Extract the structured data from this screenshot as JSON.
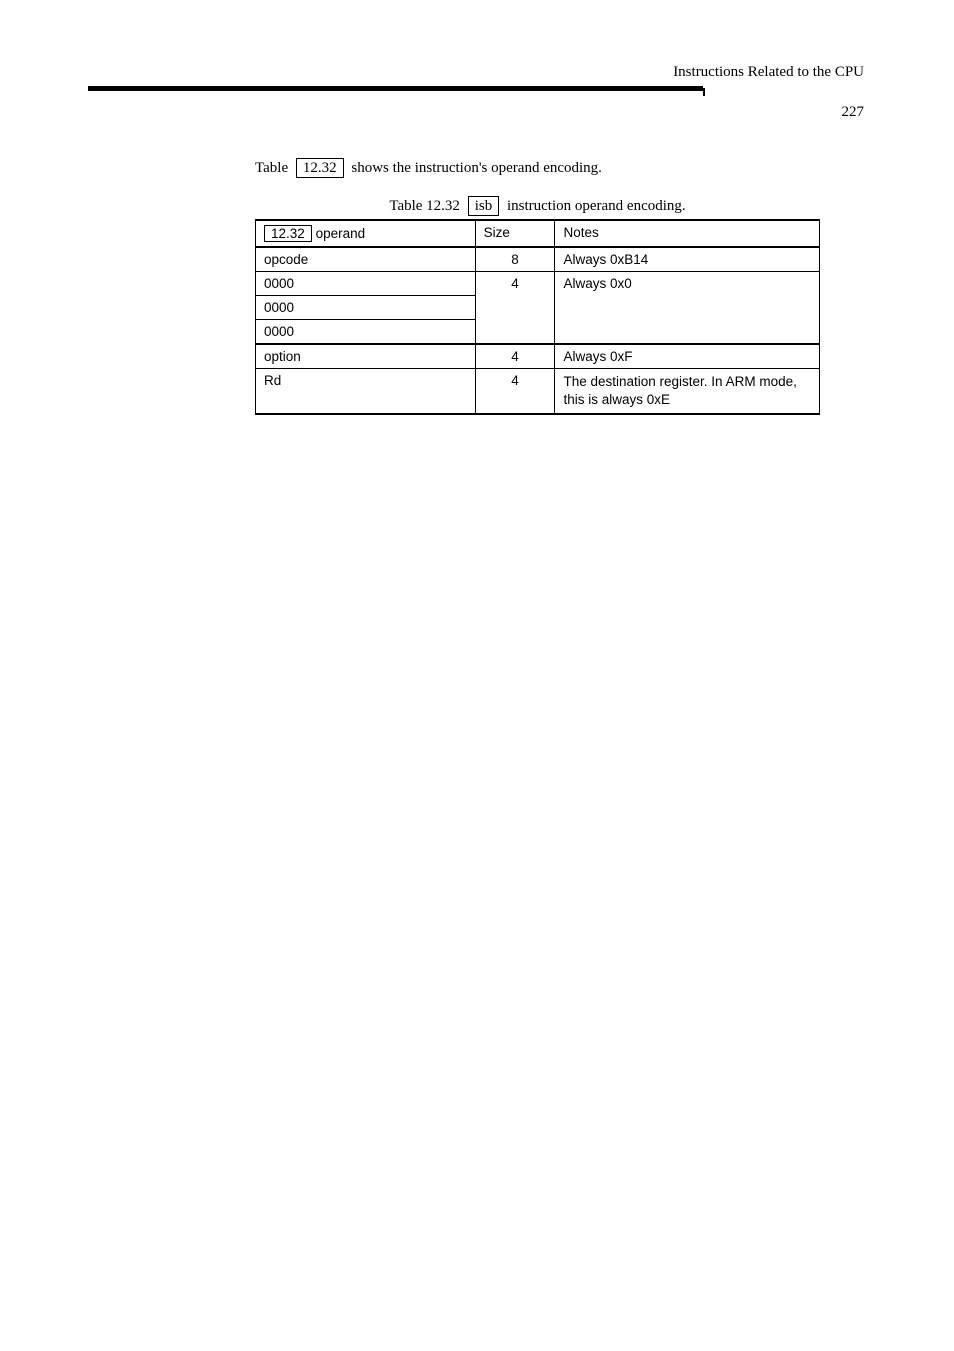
{
  "running_head": "Instructions Related to the CPU",
  "page_number": "227",
  "intro": {
    "pre": "Table",
    "ref": "12.32",
    "post": "shows the instruction's operand encoding."
  },
  "table": {
    "caption_pre": "Table 12.32",
    "caption_ref": "isb",
    "caption_post": "instruction operand encoding.",
    "headers": {
      "op_box": "12.32",
      "op_after": "operand",
      "size": "Size",
      "notes": "Notes"
    },
    "rows": [
      {
        "op": "opcode",
        "size": "8",
        "notes": "Always 0xB14"
      },
      {
        "op": "0000",
        "size": "4",
        "notes_rowspan": "Always 0x0"
      },
      {
        "op": "0000",
        "size": null,
        "leftonly": true
      },
      {
        "op": "0000",
        "size": null,
        "leftonly": true
      },
      {
        "op": "option",
        "size": "4",
        "notes": "Always 0xF",
        "sep": true
      },
      {
        "op": "Rd",
        "size": "4",
        "notes": "The destination register. In\nARM mode, this is always\n0xE",
        "multiline": true
      }
    ]
  }
}
